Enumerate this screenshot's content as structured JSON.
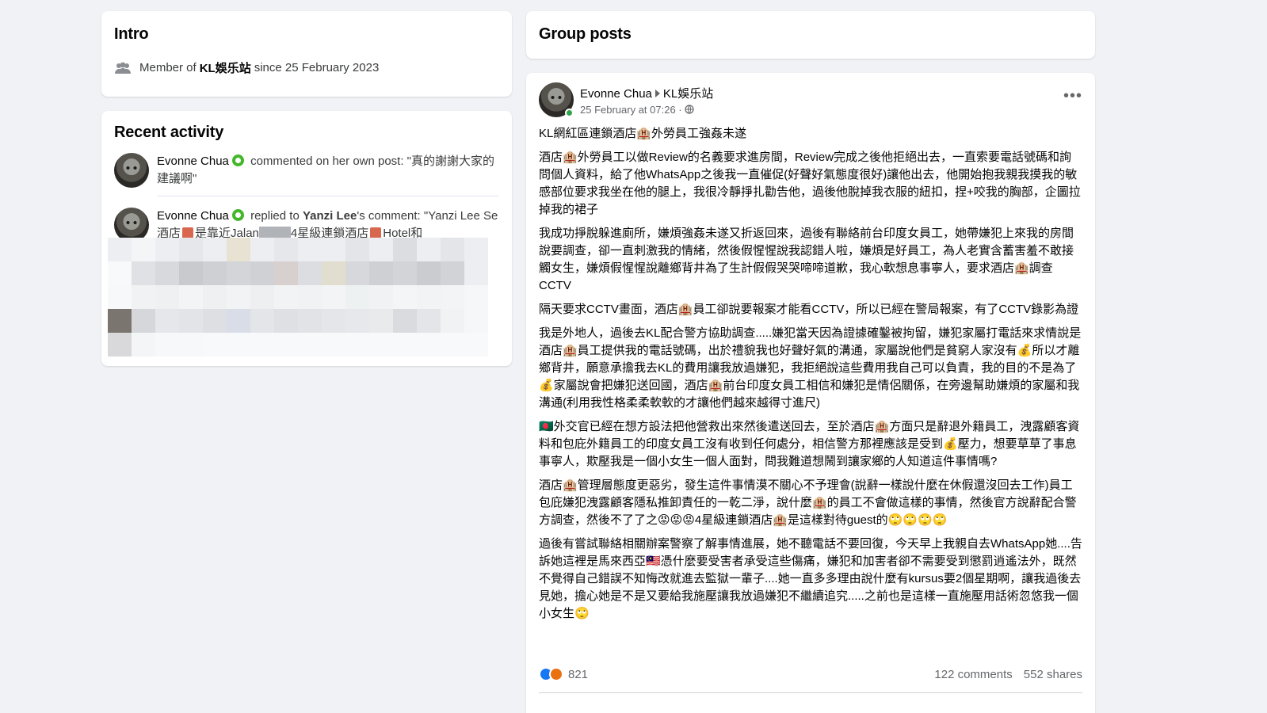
{
  "intro": {
    "title": "Intro",
    "membership": {
      "prefix": "Member of",
      "group": "KL娛乐站",
      "suffix": "since 25 February 2023"
    }
  },
  "recent": {
    "title": "Recent activity",
    "items": [
      {
        "name": "Evonne Chua",
        "action": "commented on her own post: \"真的謝謝大家的建議啊\""
      },
      {
        "name": "Evonne Chua",
        "action_prefix": "replied to",
        "target": "Yanzi Lee",
        "action_suffix": "'s comment: \"Yanzi Lee Se酒店",
        "tail1": "是靠近Jalan",
        "tail2": "4星級連鎖酒店",
        "tail3": "Hotel和"
      }
    ]
  },
  "group": {
    "title": "Group posts"
  },
  "post": {
    "author": "Evonne Chua",
    "group": "KL娛乐站",
    "date": "25 February at 07:26 ·",
    "more": "•••",
    "paragraphs": [
      "KL網紅區連鎖酒店🏨外勞員工強姦未遂",
      "酒店🏨外勞員工以做Review的名義要求進房間，Review完成之後他拒絕出去，一直索要電話號碼和詢問個人資料，給了他WhatsApp之後我一直催促(好聲好氣態度很好)讓他出去，他開始抱我親我摸我的敏感部位要求我坐在他的腿上，我很冷靜掙扎勸告他，過後他脫掉我衣服的紐扣，捏+咬我的胸部，企圖拉掉我的裙子",
      "我成功掙脫躲進廁所，嫌煩強姦未遂又折返回來，過後有聯絡前台印度女員工，她帶嫌犯上來我的房間說要調查，卻一直刺激我的情緒，然後假惺惺說我認錯人啦，嫌煩是好員工，為人老實含蓄害羞不敢接觸女生，嫌煩假惺惺說離鄉背井為了生計假假哭哭啼啼道歉，我心軟想息事寧人，要求酒店🏨調查CCTV",
      "隔天要求CCTV畫面，酒店🏨員工卻說要報案才能看CCTV，所以已經在警局報案，有了CCTV錄影為證",
      "我是外地人，過後去KL配合警方協助調查.....嫌犯當天因為證據確鑿被拘留，嫌犯家屬打電話來求情說是酒店🏨員工提供我的電話號碼，出於禮貌我也好聲好氣的溝通，家屬說他們是貧窮人家沒有💰所以才離鄉背井，願意承擔我去KL的費用讓我放過嫌犯，我拒絕說這些費用我自己可以負責，我的目的不是為了💰家屬說會把嫌犯送回國，酒店🏨前台印度女員工相信和嫌犯是情侶關係，在旁邊幫助嫌煩的家屬和我溝通(利用我性格柔柔軟軟的才讓他們越來越得寸進尺)",
      "🇧🇩外交官已經在想方設法把他營救出來然後遣送回去，至於酒店🏨方面只是辭退外籍員工，洩露顧客資料和包庇外籍員工的印度女員工沒有收到任何處分，相信警方那裡應該是受到💰壓力，想要草草了事息事寧人，欺壓我是一個小女生一個人面對，問我難道想鬧到讓家鄉的人知道這件事情嗎?",
      "酒店🏨管理層態度更惡劣，發生這件事情漠不關心不予理會(說辭一樣說什麼在休假還沒回去工作)員工包庇嫌犯洩露顧客隱私推卸責任的一乾二淨，說什麼🏨的員工不會做這樣的事情，然後官方說辭配合警方調查，然後不了了之😡😡😡4星級連鎖酒店🏨是這樣對待guest的🙄🙄🙄🙄",
      "過後有嘗試聯絡相關辦案警察了解事情進展，她不聽電話不要回復，今天早上我親自去WhatsApp她....告訴她這裡是馬來西亞🇲🇾憑什麼要受害者承受這些傷痛，嫌犯和加害者卻不需要受到懲罰逍遙法外，既然不覺得自己錯誤不知悔改就進去監獄一輩子....她一直多多理由說什麼有kursus要2個星期啊，讓我過後去見她，擔心她是不是又要給我施壓讓我放過嫌犯不繼續追究.....之前也是這樣一直施壓用話術忽悠我一個小女生🙄"
    ],
    "reactions_count": "821",
    "comments": "122 comments",
    "shares": "552 shares"
  }
}
